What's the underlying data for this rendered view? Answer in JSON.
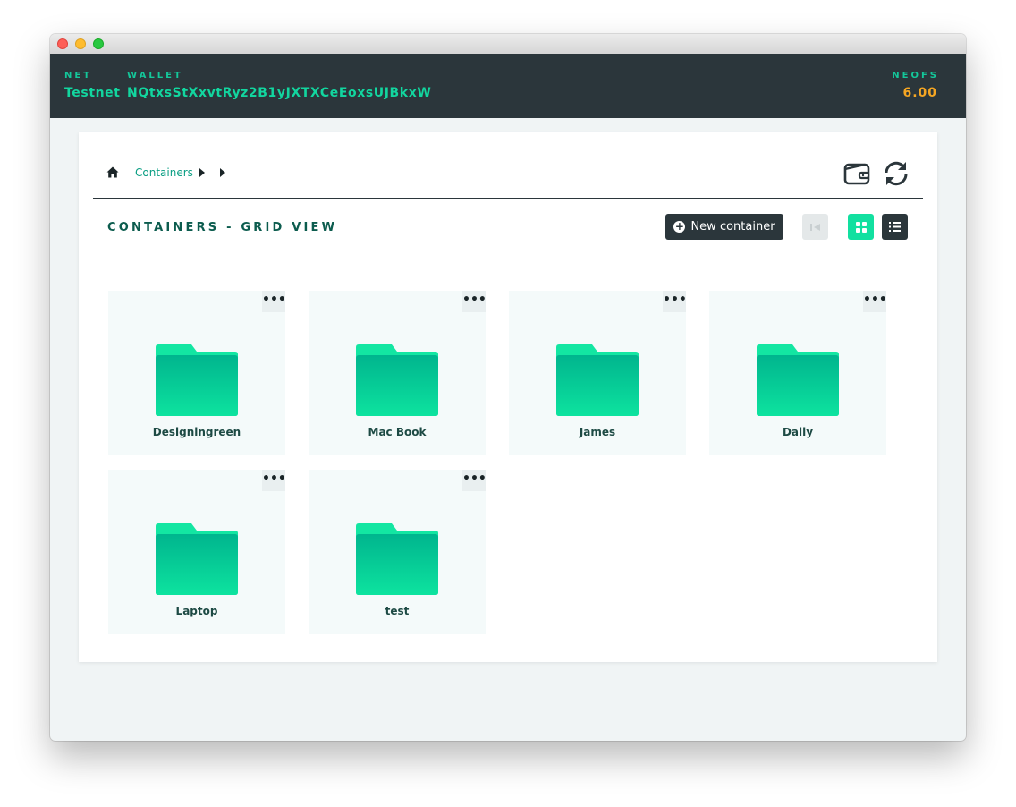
{
  "appbar": {
    "net_label": "NET",
    "net_value": "Testnet",
    "wallet_label": "WALLET",
    "wallet_value": "NQtxsStXxvtRyz2B1yJXTXCeEoxsUJBkxW",
    "neofs_label": "NEOFS",
    "neofs_value": "6.00"
  },
  "breadcrumb": {
    "home_icon": "home-icon",
    "items": [
      "Containers"
    ]
  },
  "toolbar": {
    "title": "CONTAINERS - GRID VIEW",
    "new_container_label": "New container",
    "wallet_icon": "wallet-icon",
    "refresh_icon": "refresh-icon",
    "view_mode": "grid"
  },
  "colors": {
    "appbar_bg": "#2b363b",
    "accent": "#12e0a0",
    "balance": "#f5a623",
    "folder_top": "#12e0a0",
    "folder_bottom": "#00c08f"
  },
  "containers": [
    {
      "name": "Designingreen"
    },
    {
      "name": "Mac Book"
    },
    {
      "name": "James"
    },
    {
      "name": "Daily"
    },
    {
      "name": "Laptop"
    },
    {
      "name": "test"
    }
  ]
}
